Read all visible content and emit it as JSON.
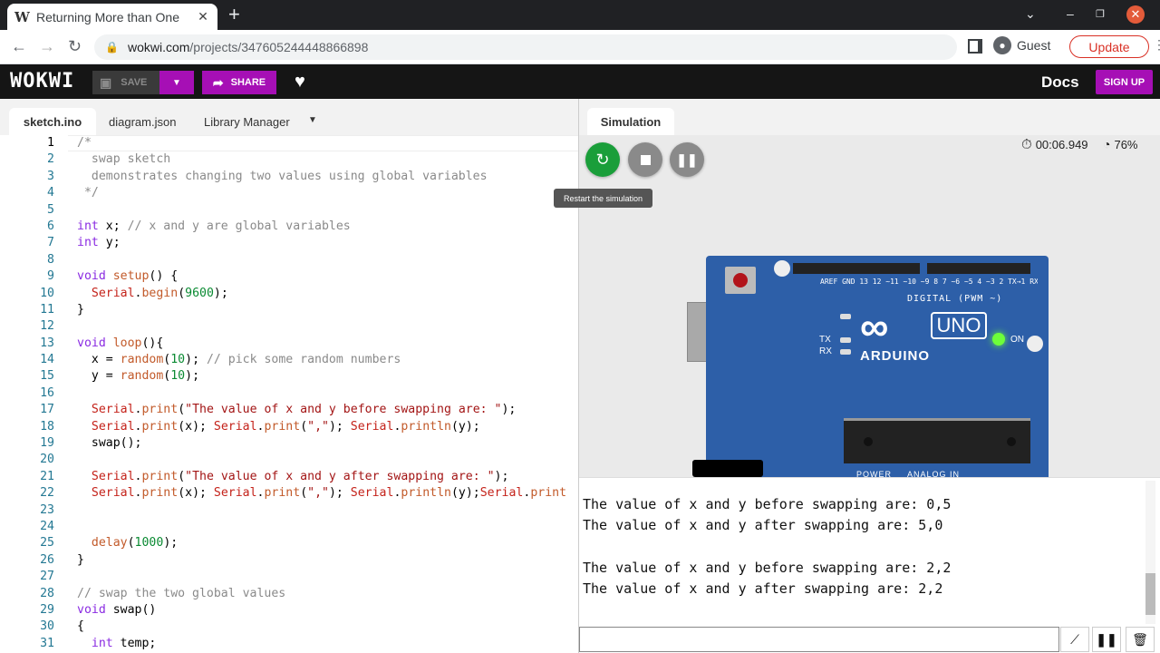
{
  "browser": {
    "tab_title": "Returning More than One",
    "tab_favicon": "W",
    "url_host": "wokwi.com",
    "url_path": "/projects/347605244448866898",
    "guest_label": "Guest",
    "update_label": "Update"
  },
  "wokwi": {
    "logo": "WOKWI",
    "save_label": "SAVE",
    "share_label": "SHARE",
    "docs_label": "Docs",
    "signup_label": "SIGN UP",
    "accent": "#a60fb5"
  },
  "editor": {
    "tabs": [
      "sketch.ino",
      "diagram.json",
      "Library Manager"
    ],
    "lines": [
      {
        "n": "1",
        "t": "/*"
      },
      {
        "n": "2",
        "t": "  swap sketch"
      },
      {
        "n": "3",
        "t": "  demonstrates changing two values using global variables"
      },
      {
        "n": "4",
        "t": " */"
      },
      {
        "n": "5",
        "t": ""
      },
      {
        "n": "6",
        "t": "int x; // x and y are global variables"
      },
      {
        "n": "7",
        "t": "int y;"
      },
      {
        "n": "8",
        "t": ""
      },
      {
        "n": "9",
        "t": "void setup() {"
      },
      {
        "n": "10",
        "t": "  Serial.begin(9600);"
      },
      {
        "n": "11",
        "t": "}"
      },
      {
        "n": "12",
        "t": ""
      },
      {
        "n": "13",
        "t": "void loop(){"
      },
      {
        "n": "14",
        "t": "  x = random(10); // pick some random numbers"
      },
      {
        "n": "15",
        "t": "  y = random(10);"
      },
      {
        "n": "16",
        "t": ""
      },
      {
        "n": "17",
        "t": "  Serial.print(\"The value of x and y before swapping are: \");"
      },
      {
        "n": "18",
        "t": "  Serial.print(x); Serial.print(\",\"); Serial.println(y);"
      },
      {
        "n": "19",
        "t": "  swap();"
      },
      {
        "n": "20",
        "t": ""
      },
      {
        "n": "21",
        "t": "  Serial.print(\"The value of x and y after swapping are: \");"
      },
      {
        "n": "22",
        "t": "  Serial.print(x); Serial.print(\",\"); Serial.println(y);Serial.print"
      },
      {
        "n": "23",
        "t": ""
      },
      {
        "n": "24",
        "t": ""
      },
      {
        "n": "25",
        "t": "  delay(1000);"
      },
      {
        "n": "26",
        "t": "}"
      },
      {
        "n": "27",
        "t": ""
      },
      {
        "n": "28",
        "t": "// swap the two global values"
      },
      {
        "n": "29",
        "t": "void swap()"
      },
      {
        "n": "30",
        "t": "{"
      },
      {
        "n": "31",
        "t": "  int temp;"
      }
    ]
  },
  "simulation": {
    "tab_label": "Simulation",
    "tooltip": "Restart the simulation",
    "timer": "00:06.949",
    "speed": "76%",
    "board": {
      "brand": "ARDUINO",
      "model": "UNO",
      "digital_label": "DIGITAL (PWM ~)",
      "on_label": "ON",
      "tx_label": "TX",
      "rx_label": "RX",
      "pin_labels": "AREF GND 13 12 ~11 ~10 ~9 8   7 ~6 ~5 4 ~3 2 TX→1 RX←0",
      "bottom_labels": "POWER     ANALOG IN"
    }
  },
  "serial": {
    "lines": [
      "The value of x and y before swapping are: 0,5",
      "The value of x and y after swapping are: 5,0",
      "",
      "The value of x and y before swapping are: 2,2",
      "The value of x and y after swapping are: 2,2"
    ]
  }
}
